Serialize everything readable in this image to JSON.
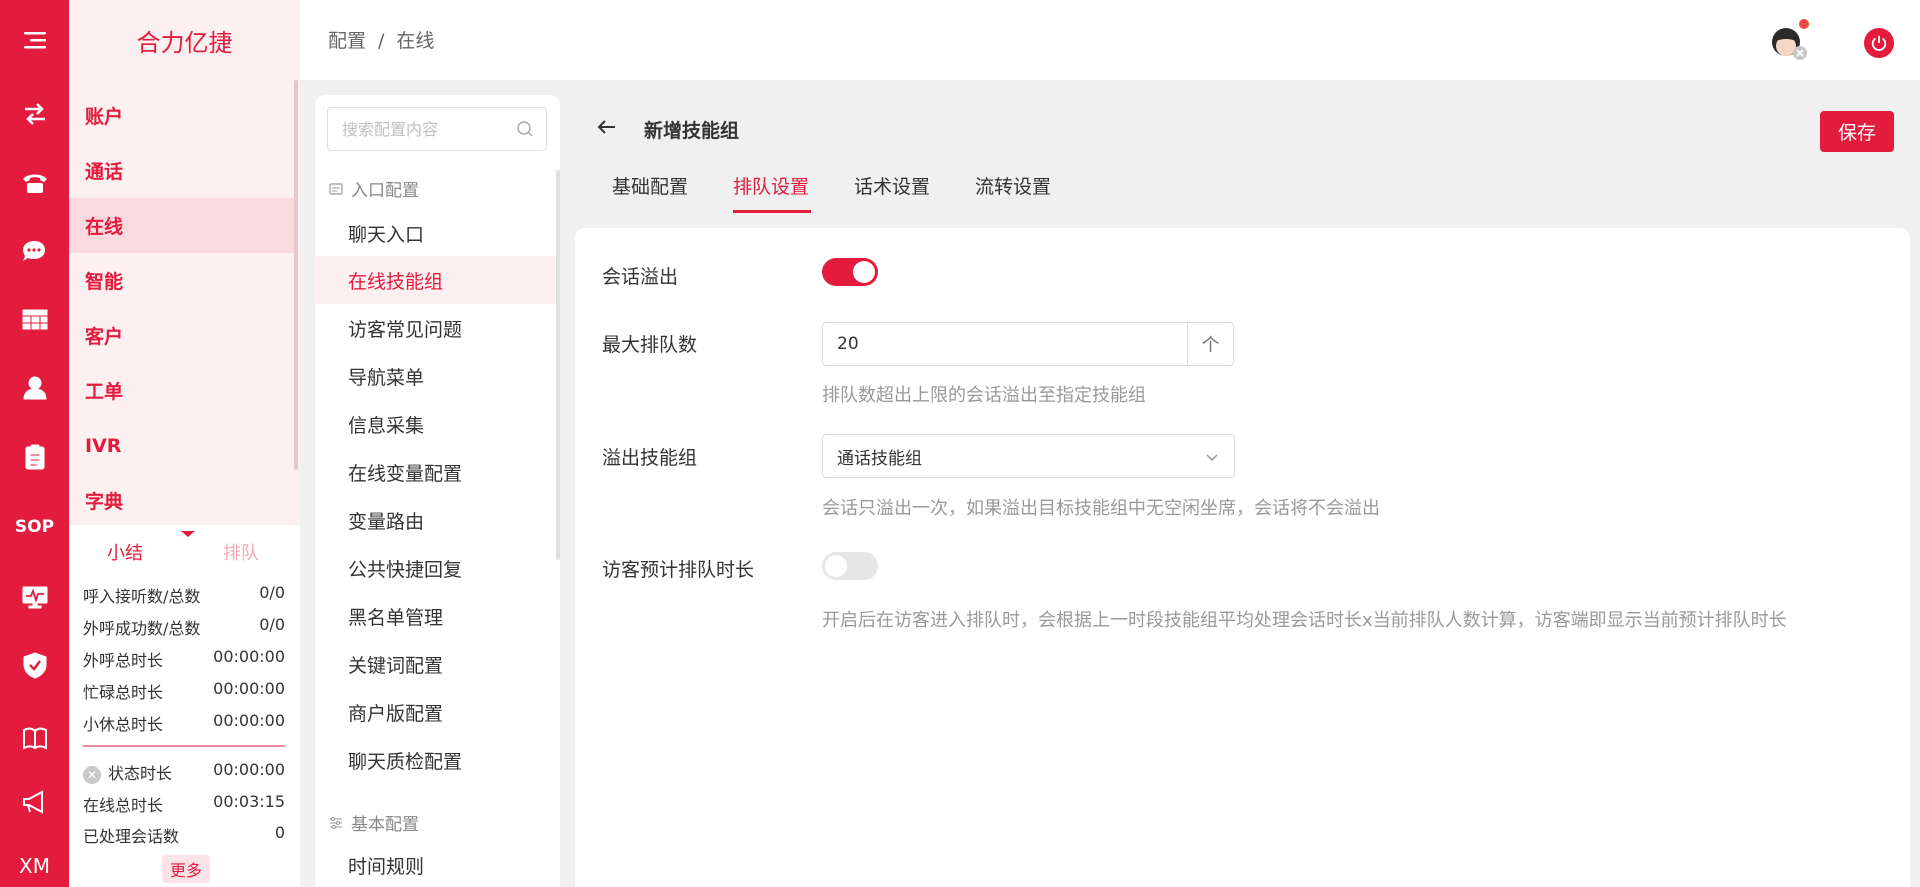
{
  "app": {
    "brand": "合力亿捷",
    "rail_sop": "SOP",
    "rail_xm": "XM"
  },
  "header": {
    "breadcrumb": [
      "配置",
      "/",
      "在线"
    ]
  },
  "left_nav": {
    "items": [
      {
        "label": "账户"
      },
      {
        "label": "通话"
      },
      {
        "label": "在线",
        "active": true
      },
      {
        "label": "智能"
      },
      {
        "label": "客户"
      },
      {
        "label": "工单"
      },
      {
        "label": "IVR"
      },
      {
        "label": "字典"
      }
    ]
  },
  "stats": {
    "tabs": {
      "summary": "小结",
      "queue": "排队"
    },
    "rows": [
      {
        "label": "呼入接听数/总数",
        "value": "0/0"
      },
      {
        "label": "外呼成功数/总数",
        "value": "0/0"
      },
      {
        "label": "外呼总时长",
        "value": "00:00:00"
      },
      {
        "label": "忙碌总时长",
        "value": "00:00:00"
      },
      {
        "label": "小休总时长",
        "value": "00:00:00"
      }
    ],
    "rows2": [
      {
        "label": "状态时长",
        "value": "00:00:00"
      },
      {
        "label": "在线总时长",
        "value": "00:03:15"
      },
      {
        "label": "已处理会话数",
        "value": "0"
      }
    ],
    "more": "更多"
  },
  "config_nav": {
    "search_placeholder": "搜索配置内容",
    "section1": "入口配置",
    "items": [
      {
        "label": "聊天入口"
      },
      {
        "label": "在线技能组",
        "active": true
      },
      {
        "label": "访客常见问题"
      },
      {
        "label": "导航菜单"
      },
      {
        "label": "信息采集"
      },
      {
        "label": "在线变量配置"
      },
      {
        "label": "变量路由"
      },
      {
        "label": "公共快捷回复"
      },
      {
        "label": "黑名单管理"
      },
      {
        "label": "关键词配置"
      },
      {
        "label": "商户版配置"
      },
      {
        "label": "聊天质检配置"
      }
    ],
    "section2": "基本配置",
    "items2": [
      {
        "label": "时间规则"
      }
    ]
  },
  "main": {
    "title": "新增技能组",
    "save": "保存",
    "tabs": [
      {
        "label": "基础配置"
      },
      {
        "label": "排队设置",
        "active": true
      },
      {
        "label": "话术设置"
      },
      {
        "label": "流转设置"
      }
    ],
    "form": {
      "overflow_label": "会话溢出",
      "overflow_on": true,
      "max_queue_label": "最大排队数",
      "max_queue_value": "20",
      "stepper_glyph": "个",
      "max_queue_hint": "排队数超出上限的会话溢出至指定技能组",
      "overflow_group_label": "溢出技能组",
      "overflow_group_value": "通话技能组",
      "overflow_group_hint": "会话只溢出一次，如果溢出目标技能组中无空闲坐席，会话将不会溢出",
      "eta_label": "访客预计排队时长",
      "eta_on": false,
      "eta_hint": "开启后在访客进入排队时，会根据上一时段技能组平均处理会话时长x当前排队人数计算，访客端即显示当前预计排队时长"
    }
  },
  "colors": {
    "accent": "#e31c3d",
    "rail_bg": "#e31c3d",
    "panel_bg": "#fdf0f0"
  }
}
